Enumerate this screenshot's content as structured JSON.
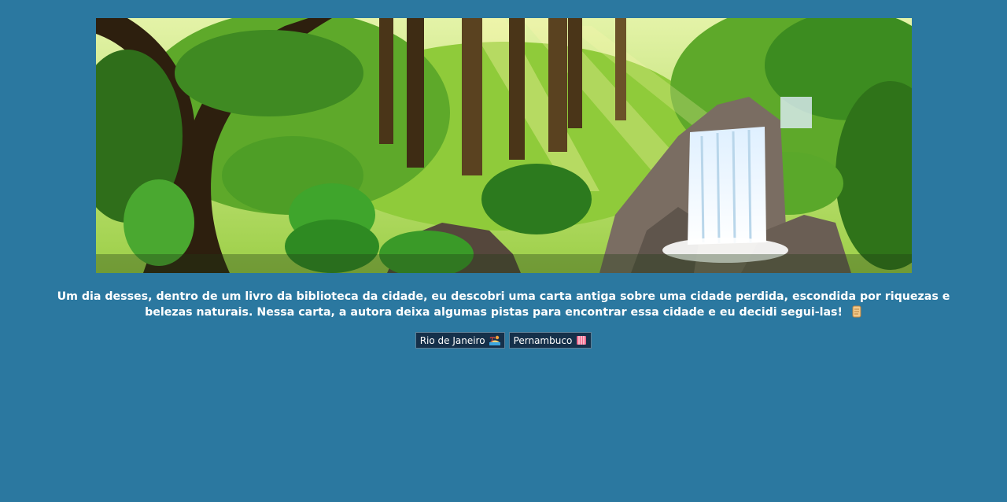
{
  "hero": {
    "scene_icon": "rainforest-waterfall-illustration",
    "colors": {
      "sky": "#cfe88a",
      "foliage_dark": "#1f5a1a",
      "foliage_light": "#7cc22e",
      "trunk": "#3a2a16",
      "rock": "#6e6258",
      "water": "#eaf6ff"
    }
  },
  "story": {
    "text": "Um dia desses, dentro de um livro da biblioteca da cidade, eu descobri uma carta antiga sobre uma cidade perdida, escondida por riquezas e belezas naturais. Nessa carta, a autora deixa algumas pistas para encontrar essa cidade e eu decidi segui-las!",
    "icon": "scroll-icon"
  },
  "choices": [
    {
      "label": "Rio de Janeiro",
      "icon": "beach-icon"
    },
    {
      "label": "Pernambuco",
      "icon": "ticket-icon"
    }
  ],
  "colors": {
    "background": "#2b78a0",
    "button_bg": "#15304a",
    "text": "#ffffff"
  }
}
